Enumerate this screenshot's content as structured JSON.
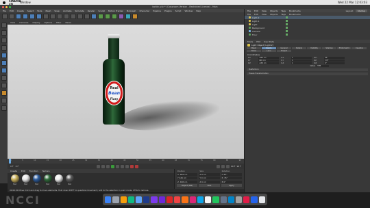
{
  "menubar": {
    "app": "CINEMA 4D",
    "window": "Window",
    "clock": "Wed 22 Mar 12:03:03"
  },
  "window_title": "bottle_v4c * (Classroom Version - Restricted License) - Main",
  "c4d_menu": [
    "File",
    "Edit",
    "Create",
    "Select",
    "Tools",
    "Mesh",
    "Snap",
    "Animate",
    "Simulate",
    "Render",
    "Sculpt",
    "Motion Tracker",
    "MoGraph",
    "Character",
    "Pipeline",
    "Plugins",
    "Script",
    "Window",
    "Help"
  ],
  "right_menu": {
    "items": [
      "File",
      "Edit",
      "View",
      "Objects",
      "Tags",
      "Bookmarks"
    ],
    "layout_label": "Layout:",
    "layout_value": "Startup"
  },
  "viewport_menu": [
    "View",
    "Cameras",
    "Display",
    "Options",
    "Filter",
    "Panel"
  ],
  "bottle_label": {
    "line1": "Real",
    "line2": "Bean",
    "line3": "Fizzy"
  },
  "timeline_ticks": [
    "0",
    "5",
    "10",
    "15",
    "20",
    "25",
    "30",
    "35",
    "40",
    "45",
    "50",
    "55",
    "60",
    "65",
    "70",
    "75",
    "80",
    "85",
    "90"
  ],
  "transport": {
    "start": "0 F",
    "current": "0 F",
    "end": "90 F",
    "end2": "90 F"
  },
  "material_menu": [
    "Create",
    "Edit",
    "Function",
    "Texture"
  ],
  "materials": [
    {
      "name": "Mat",
      "color": "#c9b05a"
    },
    {
      "name": "Mat",
      "color": "#e6e6e6"
    },
    {
      "name": "Mat",
      "color": "#2b5a9a"
    },
    {
      "name": "Mat",
      "color": "#2f6a3a"
    },
    {
      "name": "Mat",
      "color": "#ededed"
    },
    {
      "name": "Mat",
      "color": "#5a5a5a"
    }
  ],
  "coords": {
    "headers": [
      "Position",
      "Size",
      "Rotation"
    ],
    "rows": [
      [
        "X  -664 cm",
        "X  0 cm",
        "H  45°"
      ],
      [
        "Y  426 cm",
        "Y  0 cm",
        "P  -35°"
      ],
      [
        "Z  -638 cm",
        "Z  0 cm",
        "B  0°"
      ]
    ],
    "mode": "Object (Rel)",
    "size_mode": "Size",
    "apply": "Apply"
  },
  "status": "00:00:00  Move: Click and drag to move elements. Hold down SHIFT to quantize movement / add to the selection in point mode, CTRL to remove.",
  "objects_tabs": [
    "File",
    "Edit",
    "View",
    "Objects",
    "Tags",
    "Bookmarks"
  ],
  "objects": [
    {
      "name": "Light.2",
      "kind": "light",
      "selected": true
    },
    {
      "name": "Light.1",
      "kind": "light",
      "selected": false
    },
    {
      "name": "Light",
      "kind": "light",
      "selected": false
    },
    {
      "name": "Background",
      "kind": "geo",
      "selected": false
    },
    {
      "name": "Camera",
      "kind": "cam",
      "selected": false
    },
    {
      "name": "Floor",
      "kind": "geo",
      "selected": false
    }
  ],
  "attr_tabs": [
    "Mode",
    "Edit",
    "User Data"
  ],
  "attr_title": "Light Object [Light.2]",
  "light_tabs": [
    "Basic",
    "Coord.",
    "General",
    "Details",
    "Visibility",
    "Shadow",
    "Photometric",
    "Caustics",
    "Noise",
    "Lens",
    "Project"
  ],
  "light_tab_active": "Coord.",
  "coordinates_header": "Coordinates",
  "params": [
    [
      "P.X",
      "-664 cm",
      "S.X",
      "1",
      "R.H",
      "45°"
    ],
    [
      "P.Y",
      "426 cm",
      "S.Y",
      "1",
      "R.P",
      "-35°"
    ],
    [
      "P.Z",
      "-638 cm",
      "S.Z",
      "1",
      "R.B",
      "0°"
    ]
  ],
  "order_label": "Order",
  "order_value": "HPB",
  "sections": [
    "Quaternion",
    "Freeze Transformation"
  ],
  "dock_apps": [
    "#3b82f6",
    "#9ca3af",
    "#f59e0b",
    "#10b981",
    "#60a5fa",
    "#1e3a8a",
    "#7c3aed",
    "#6d28d9",
    "#dc2626",
    "#ef4444",
    "#f97316",
    "#db2777",
    "#0ea5e9",
    "#f5f5f5",
    "#22c55e",
    "#64748b",
    "#0284c7",
    "#a3a3a3",
    "#e11d48",
    "#2563eb",
    "#e5e7eb"
  ],
  "watermark": "NCCI"
}
